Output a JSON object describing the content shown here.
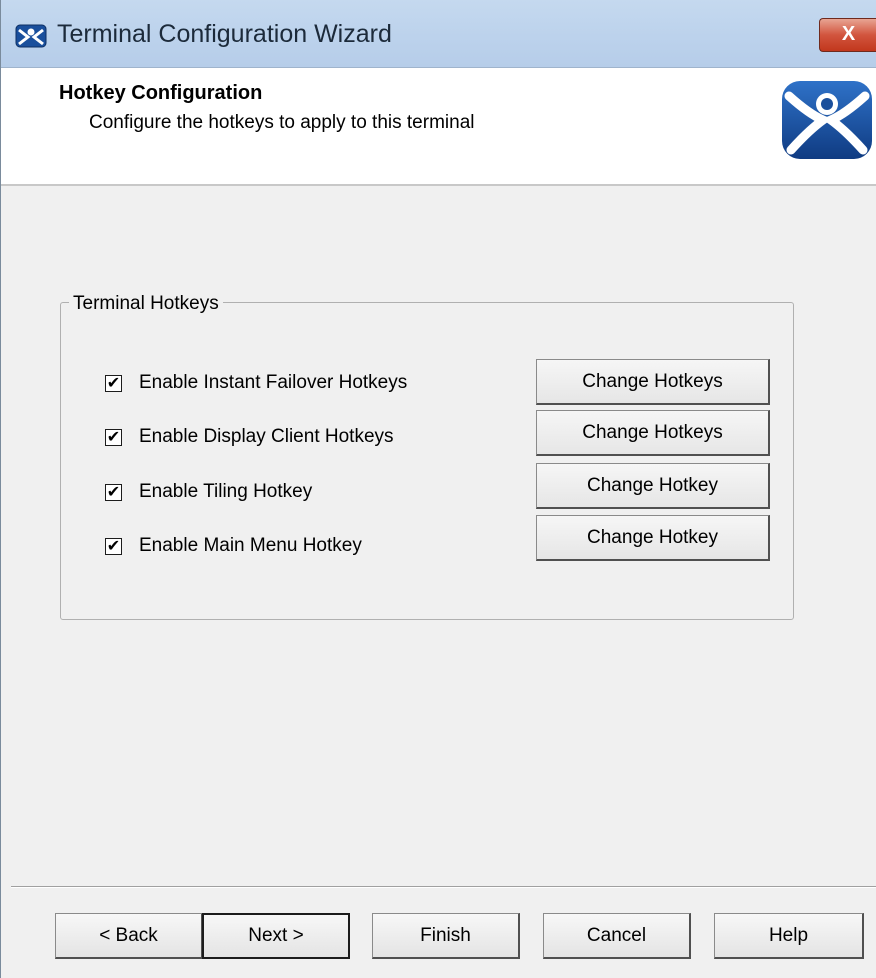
{
  "window": {
    "title": "Terminal Configuration Wizard",
    "close_label": "X",
    "title_icon": "thinmanager-icon",
    "accent": "#bcd2ec",
    "close_color": "#c8452b"
  },
  "header": {
    "title": "Hotkey Configuration",
    "subtitle": "Configure the hotkeys to apply to this terminal",
    "logo_icon": "thinmanager-logo-icon",
    "logo_color": "#1a4f9c"
  },
  "group": {
    "legend": "Terminal Hotkeys",
    "items": [
      {
        "label": "Enable Instant Failover Hotkeys",
        "checked": true,
        "button": "Change Hotkeys"
      },
      {
        "label": "Enable Display Client Hotkeys",
        "checked": true,
        "button": "Change Hotkeys"
      },
      {
        "label": "Enable Tiling Hotkey",
        "checked": true,
        "button": "Change Hotkey"
      },
      {
        "label": "Enable Main Menu Hotkey",
        "checked": true,
        "button": "Change Hotkey"
      }
    ],
    "check_mark": "✔"
  },
  "nav": {
    "back": "< Back",
    "next": "Next >",
    "finish": "Finish",
    "cancel": "Cancel",
    "help": "Help"
  }
}
